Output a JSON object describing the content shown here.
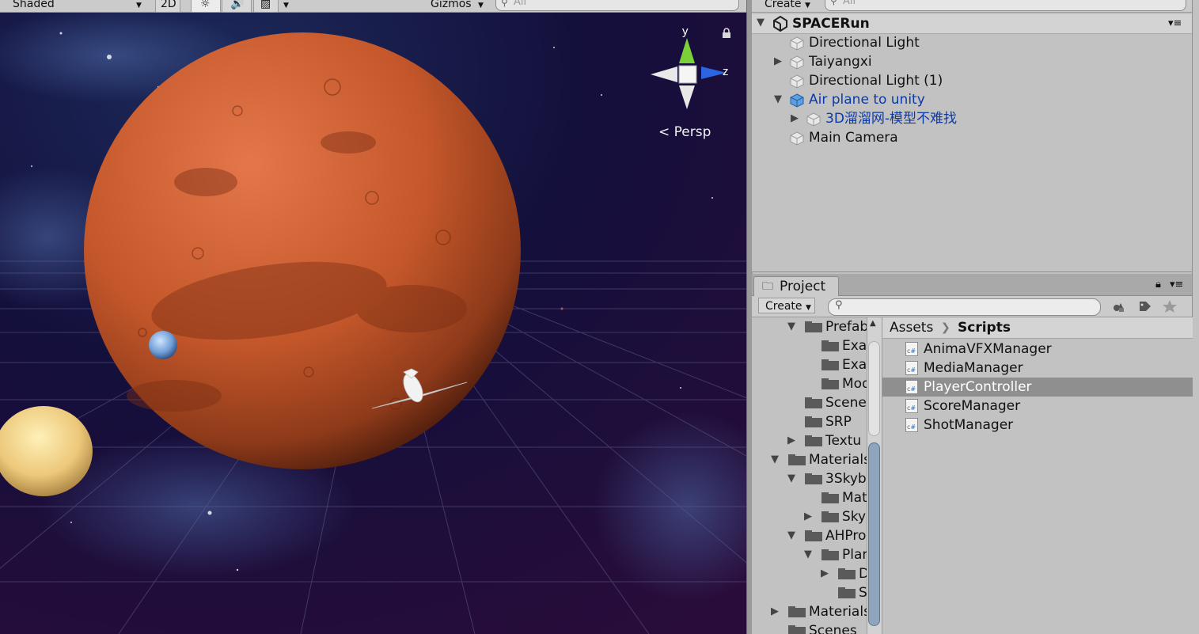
{
  "scene_view": {
    "toolbar": {
      "shading_mode": "Shaded",
      "mode_2d": "2D",
      "gizmos": "Gizmos",
      "search_placeholder": "All"
    },
    "projection_label": "Persp",
    "gizmo_axes": {
      "y": "y",
      "z": "z"
    }
  },
  "hierarchy": {
    "create_label": "Create",
    "search_placeholder": "All",
    "scene_name": "SPACERun",
    "items": [
      {
        "label": "Directional Light"
      },
      {
        "label": "Taiyangxi"
      },
      {
        "label": "Directional Light (1)"
      },
      {
        "label": "Air plane to unity"
      },
      {
        "label": "3D溜溜网-模型不难找"
      },
      {
        "label": "Main Camera"
      }
    ]
  },
  "project": {
    "tab_label": "Project",
    "create_label": "Create",
    "breadcrumb": {
      "root": "Assets",
      "current": "Scripts"
    },
    "tree": [
      {
        "label": "Prefab"
      },
      {
        "label": "Exa"
      },
      {
        "label": "Exa"
      },
      {
        "label": "Mod"
      },
      {
        "label": "Scene"
      },
      {
        "label": "SRP"
      },
      {
        "label": "Textu"
      },
      {
        "label": "Materials"
      },
      {
        "label": "3Skyb"
      },
      {
        "label": "Mat"
      },
      {
        "label": "Sky"
      },
      {
        "label": "AHPro"
      },
      {
        "label": "Plar"
      },
      {
        "label": "D"
      },
      {
        "label": "S"
      },
      {
        "label": "Materials"
      },
      {
        "label": "Scenes"
      }
    ],
    "scripts": [
      {
        "label": "AnimaVFXManager"
      },
      {
        "label": "MediaManager"
      },
      {
        "label": "PlayerController"
      },
      {
        "label": "ScoreManager"
      },
      {
        "label": "ShotManager"
      }
    ],
    "script_icon_text": "c#"
  },
  "colors": {
    "prefab_text": "#0b3aa6",
    "selection": "#8f8f8f",
    "mars": "#c4572a",
    "space": "#0b0a26"
  }
}
